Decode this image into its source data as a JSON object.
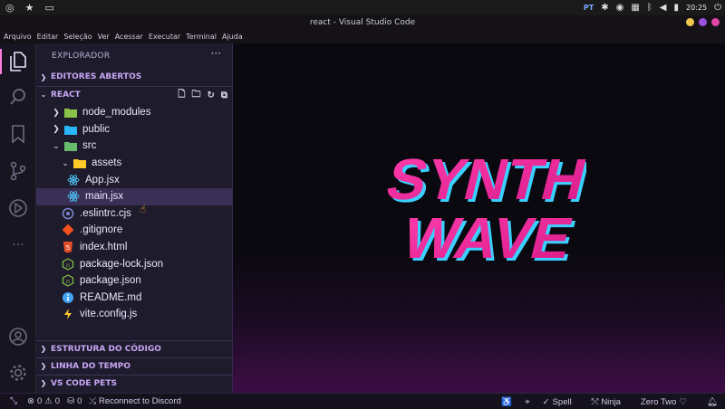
{
  "window_title": "react - Visual Studio Code",
  "system": {
    "lang": "PT",
    "time": "20:25"
  },
  "menu": [
    "Arquivo",
    "Editar",
    "Seleção",
    "Ver",
    "Acessar",
    "Executar",
    "Terminal",
    "Ajuda"
  ],
  "sidebar": {
    "title": "EXPLORADOR",
    "open_editors": "EDITORES ABERTOS",
    "project": "REACT",
    "tree": [
      {
        "label": "node_modules",
        "type": "folder",
        "depth": 0,
        "expanded": false,
        "icon": "folder-node-icon"
      },
      {
        "label": "public",
        "type": "folder",
        "depth": 0,
        "expanded": false,
        "icon": "folder-public-icon"
      },
      {
        "label": "src",
        "type": "folder",
        "depth": 0,
        "expanded": true,
        "icon": "folder-src-icon"
      },
      {
        "label": "assets",
        "type": "folder",
        "depth": 1,
        "expanded": true,
        "icon": "folder-assets-icon"
      },
      {
        "label": "App.jsx",
        "type": "file",
        "depth": 1,
        "icon": "react-icon"
      },
      {
        "label": "main.jsx",
        "type": "file",
        "depth": 1,
        "icon": "react-icon",
        "selected": true
      },
      {
        "label": ".eslintrc.cjs",
        "type": "file",
        "depth": 0,
        "icon": "eslint-icon"
      },
      {
        "label": ".gitignore",
        "type": "file",
        "depth": 0,
        "icon": "git-icon"
      },
      {
        "label": "index.html",
        "type": "file",
        "depth": 0,
        "icon": "html-icon"
      },
      {
        "label": "package-lock.json",
        "type": "file",
        "depth": 0,
        "icon": "nodejs-icon"
      },
      {
        "label": "package.json",
        "type": "file",
        "depth": 0,
        "icon": "nodejs-icon"
      },
      {
        "label": "README.md",
        "type": "file",
        "depth": 0,
        "icon": "info-icon"
      },
      {
        "label": "vite.config.js",
        "type": "file",
        "depth": 0,
        "icon": "vite-icon"
      }
    ],
    "outline": "ESTRUTURA DO CÓDIGO",
    "timeline": "LINHA DO TEMPO",
    "pets": "VS CODE PETS"
  },
  "editor": {
    "logo_line1": "SYNTH",
    "logo_line2": "WAVE"
  },
  "status": {
    "errors": "0",
    "warnings": "0",
    "ports": "0",
    "discord": "Reconnect to Discord",
    "spell": "Spell",
    "ninja": "Ninja",
    "theme": "Zero Two"
  },
  "colors": {
    "accent": "#ff7edb",
    "sidebar_bg": "#1e1b2c",
    "section_header": "#c7a7f5",
    "logo_pink": "#ff2fa3",
    "logo_blue": "#3ad0ff"
  }
}
